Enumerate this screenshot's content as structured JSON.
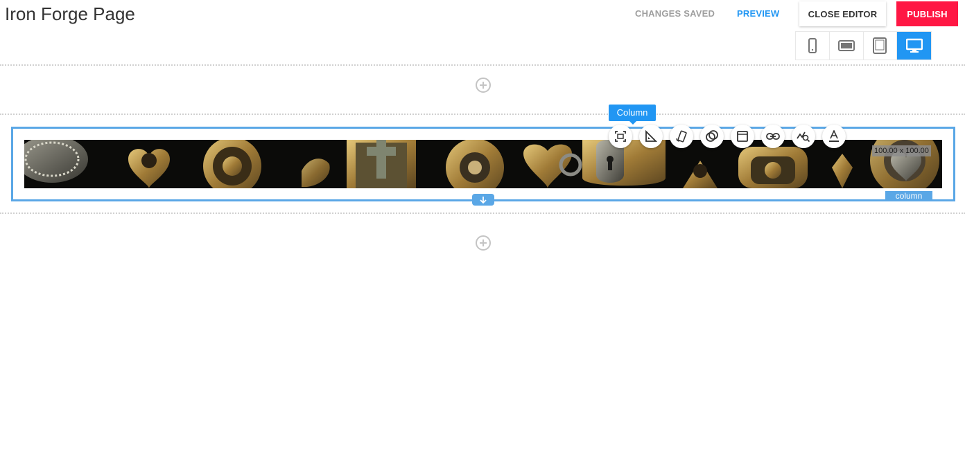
{
  "header": {
    "title": "Iron Forge Page",
    "status": "CHANGES SAVED",
    "preview_label": "PREVIEW",
    "close_label": "CLOSE EDITOR",
    "publish_label": "PUBLISH"
  },
  "devices": [
    {
      "icon": "mobile-portrait-icon",
      "active": false
    },
    {
      "icon": "mobile-landscape-icon",
      "active": false
    },
    {
      "icon": "tablet-icon",
      "active": false
    },
    {
      "icon": "desktop-icon",
      "active": true
    }
  ],
  "editor": {
    "column_tag": "Column",
    "size_label": "100.00 x 100.00",
    "column_label": "column",
    "image_description_visible": "black jewellery banner image",
    "toolbar": [
      "crop-icon",
      "set-square-icon",
      "rotate-icon",
      "layers-icon",
      "frame-icon",
      "link-icon",
      "seo-search-icon",
      "text-color-icon"
    ]
  },
  "colors": {
    "accent": "#2196f3",
    "publish": "#ff1744",
    "selection": "#5aa7e6",
    "status_text": "#9e9e9e"
  }
}
